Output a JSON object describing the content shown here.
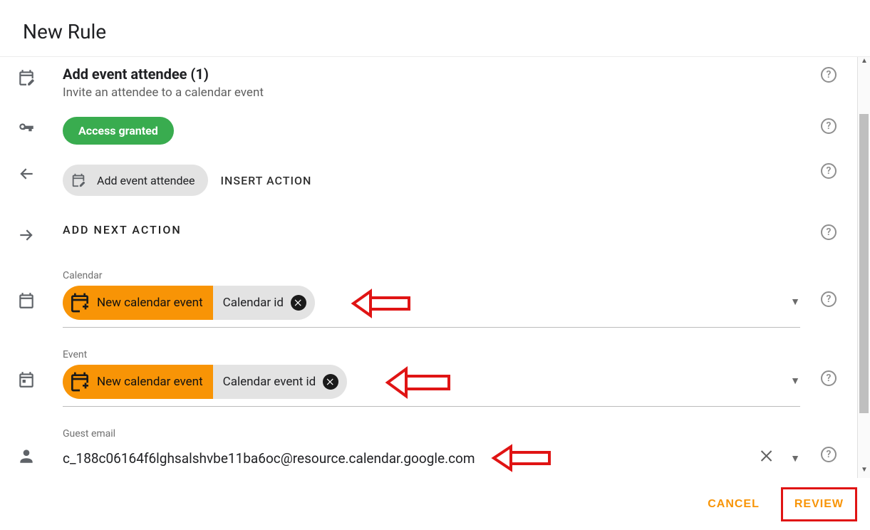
{
  "header": {
    "title": "New Rule"
  },
  "summary": {
    "title": "Add event attendee (1)",
    "description": "Invite an attendee to a calendar event"
  },
  "access": {
    "label": "Access granted"
  },
  "insert_action": {
    "chip_label": "Add event attendee",
    "caption": "INSERT ACTION"
  },
  "add_next": {
    "caption": "ADD NEXT ACTION"
  },
  "calendar_field": {
    "label": "Calendar",
    "chip_source": "New calendar event",
    "chip_prop": "Calendar id"
  },
  "event_field": {
    "label": "Event",
    "chip_source": "New calendar event",
    "chip_prop": "Calendar event id"
  },
  "guest_email": {
    "label": "Guest email",
    "value": "c_188c06164f6lghsalshvbe11ba6oc@resource.calendar.google.com"
  },
  "footer": {
    "cancel": "CANCEL",
    "review": "REVIEW"
  }
}
